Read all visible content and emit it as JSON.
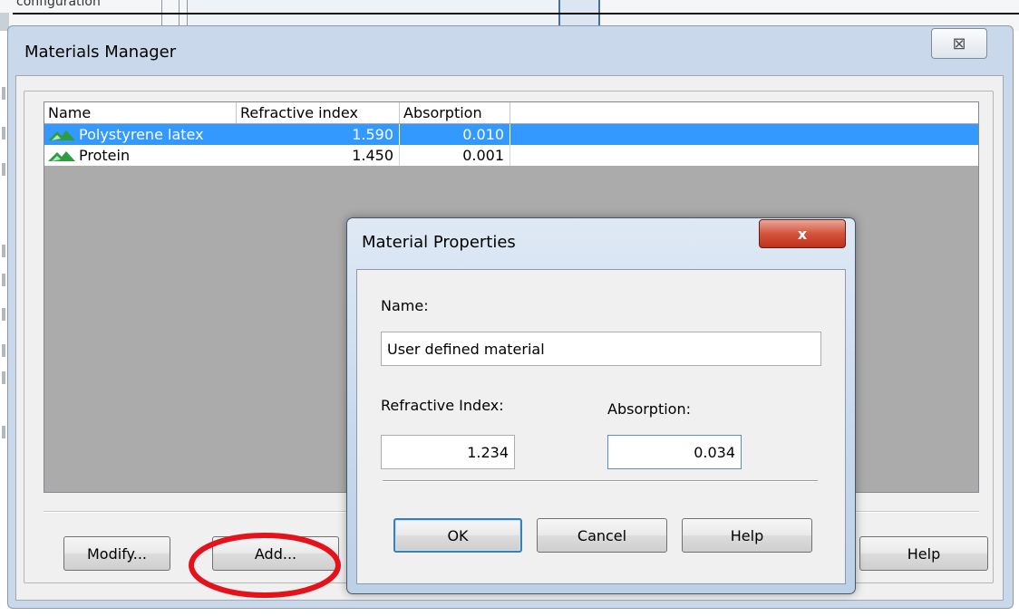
{
  "background": {
    "strip_text": "configuration"
  },
  "materials_manager": {
    "title": "Materials Manager",
    "close_glyph": "⊠",
    "columns": [
      "Name",
      "Refractive index",
      "Absorption"
    ],
    "rows": [
      {
        "name": "Polystyrene latex",
        "refractive_index": "1.590",
        "absorption": "0.010",
        "selected": true
      },
      {
        "name": "Protein",
        "refractive_index": "1.450",
        "absorption": "0.001",
        "selected": false
      }
    ],
    "buttons": {
      "modify": "Modify...",
      "add": "Add...",
      "help": "Help"
    }
  },
  "material_properties": {
    "title": "Material Properties",
    "close_glyph": "x",
    "name_label": "Name:",
    "name_value": "User defined material",
    "refractive_label": "Refractive Index:",
    "refractive_value": "1.234",
    "absorption_label": "Absorption:",
    "absorption_value": "0.034",
    "buttons": {
      "ok": "OK",
      "cancel": "Cancel",
      "help": "Help"
    }
  },
  "colors": {
    "selection": "#3399ff",
    "material_icon": "#2e9d3f",
    "annotation": "#e5121b",
    "close_red": "#c8402a"
  },
  "icons": {
    "material": "mountain-icon",
    "close": "close-icon"
  }
}
